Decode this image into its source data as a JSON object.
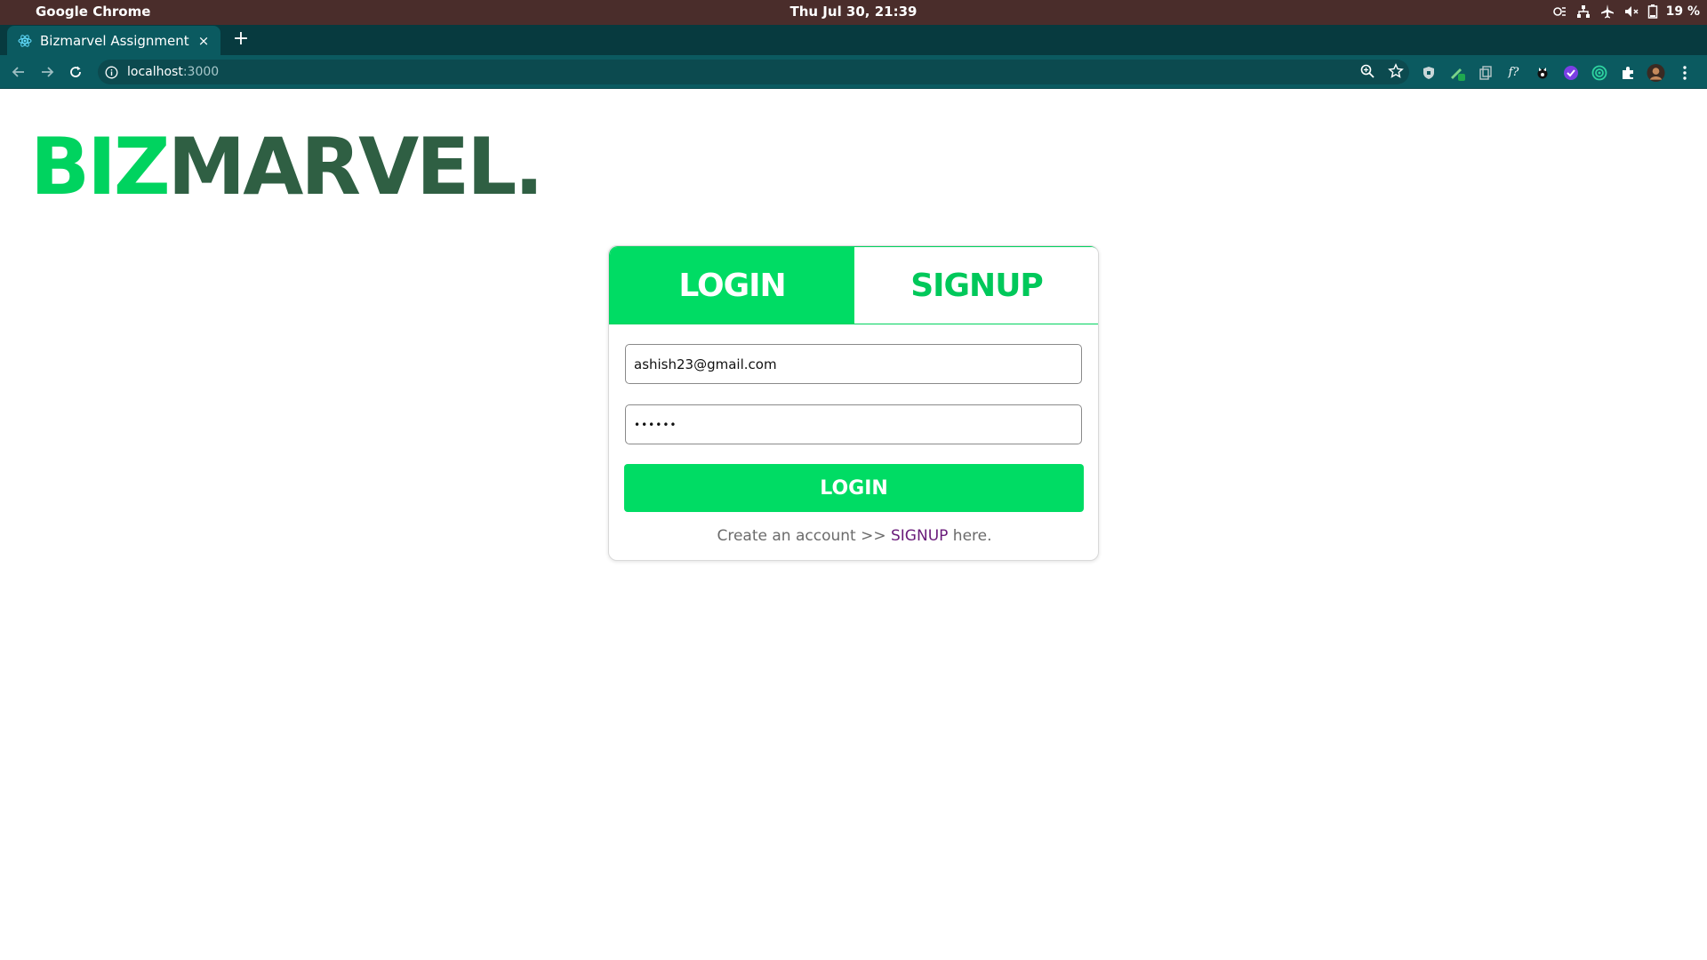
{
  "os_bar": {
    "app_name": "Google Chrome",
    "clock": "Thu Jul 30, 21:39",
    "battery": "19 %"
  },
  "browser": {
    "tab": {
      "title": "Bizmarvel Assignment",
      "favicon": "react-icon"
    },
    "new_tab_icon": "+",
    "close_icon": "×",
    "url_host": "localhost",
    "url_port": ":3000",
    "extension_icons": [
      "shield-extension-icon",
      "pencil-extension-icon",
      "copy-extension-icon",
      "fx-extension-icon",
      "fox-extension-icon",
      "check-extension-icon",
      "target-extension-icon",
      "puzzle-icon",
      "profile-avatar",
      "menu-icon"
    ]
  },
  "page": {
    "logo": {
      "part1": "BIZ",
      "part2": "MARVEL."
    },
    "tabs": {
      "login": "LOGIN",
      "signup": "SIGNUP"
    },
    "form": {
      "email_value": "ashish23@gmail.com",
      "password_value": "••••••",
      "submit_label": "LOGIN"
    },
    "footer": {
      "prefix": "Create an account >> ",
      "link": "SIGNUP",
      "suffix": " here."
    }
  },
  "colors": {
    "accent_green": "#00dc64",
    "logo_dark_green": "#2f5f43",
    "link_purple": "#6a1b7a",
    "browser_teal": "#0b5a60"
  }
}
